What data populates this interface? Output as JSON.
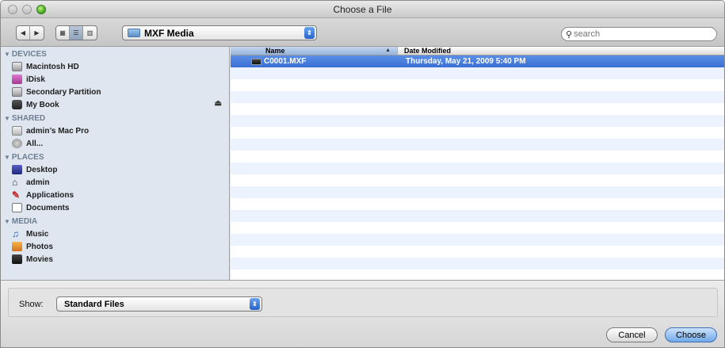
{
  "window": {
    "title": "Choose a File"
  },
  "toolbar": {
    "back_icon": "back-arrow-icon",
    "forward_icon": "forward-arrow-icon",
    "location": "MXF Media",
    "search_placeholder": "search"
  },
  "sidebar": {
    "groups": [
      {
        "title": "DEVICES",
        "items": [
          {
            "label": "Macintosh HD",
            "icon": "hard-drive-icon"
          },
          {
            "label": "iDisk",
            "icon": "idisk-icon"
          },
          {
            "label": "Secondary Partition",
            "icon": "hard-drive-icon"
          },
          {
            "label": "My Book",
            "icon": "external-drive-icon",
            "eject": true
          }
        ]
      },
      {
        "title": "SHARED",
        "items": [
          {
            "label": "admin’s Mac Pro",
            "icon": "computer-icon"
          },
          {
            "label": "All...",
            "icon": "network-icon"
          }
        ]
      },
      {
        "title": "PLACES",
        "items": [
          {
            "label": "Desktop",
            "icon": "desktop-icon"
          },
          {
            "label": "admin",
            "icon": "home-icon"
          },
          {
            "label": "Applications",
            "icon": "applications-icon"
          },
          {
            "label": "Documents",
            "icon": "documents-icon"
          }
        ]
      },
      {
        "title": "MEDIA",
        "items": [
          {
            "label": "Music",
            "icon": "music-icon"
          },
          {
            "label": "Photos",
            "icon": "photos-icon"
          },
          {
            "label": "Movies",
            "icon": "movies-icon"
          }
        ]
      }
    ]
  },
  "list": {
    "columns": {
      "name": "Name",
      "date": "Date Modified"
    },
    "rows": [
      {
        "name": "C0001.MXF",
        "date": "Thursday, May 21, 2009 5:40 PM",
        "selected": true
      }
    ]
  },
  "footer": {
    "show_label": "Show:",
    "show_value": "Standard Files",
    "cancel": "Cancel",
    "choose": "Choose"
  }
}
